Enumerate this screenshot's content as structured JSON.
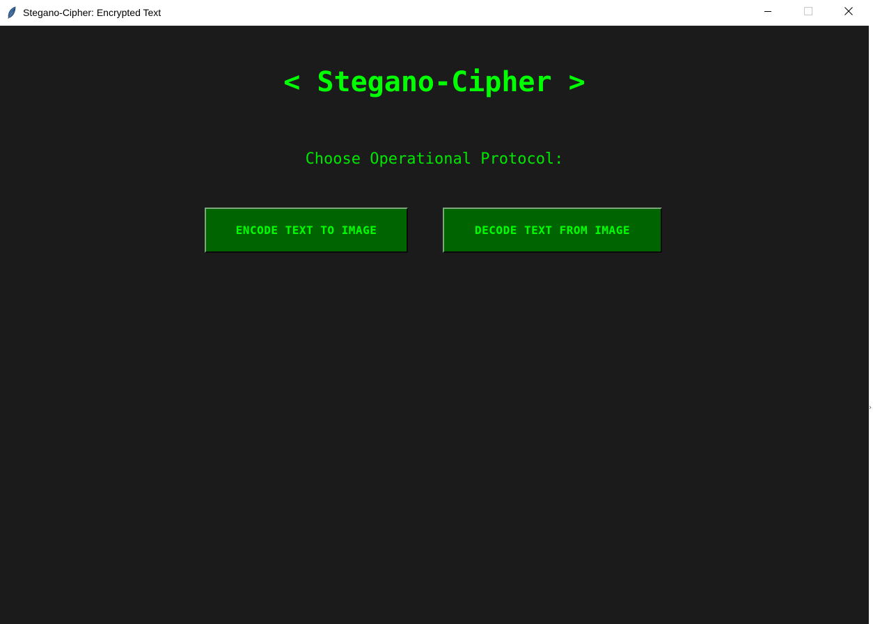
{
  "window": {
    "title": "Stegano-Cipher: Encrypted Text",
    "icon": "feather-icon",
    "controls": {
      "minimize_icon": "minimize-icon",
      "maximize_icon": "maximize-icon",
      "close_icon": "close-icon"
    }
  },
  "main": {
    "heading": "< Stegano-Cipher >",
    "prompt": "Choose Operational Protocol:",
    "buttons": {
      "encode_label": "ENCODE TEXT TO IMAGE",
      "decode_label": "DECODE TEXT FROM IMAGE"
    }
  },
  "colors": {
    "background": "#1b1b1b",
    "accent_text": "#00ff00",
    "button_bg": "#006400",
    "titlebar_bg": "#ffffff"
  }
}
